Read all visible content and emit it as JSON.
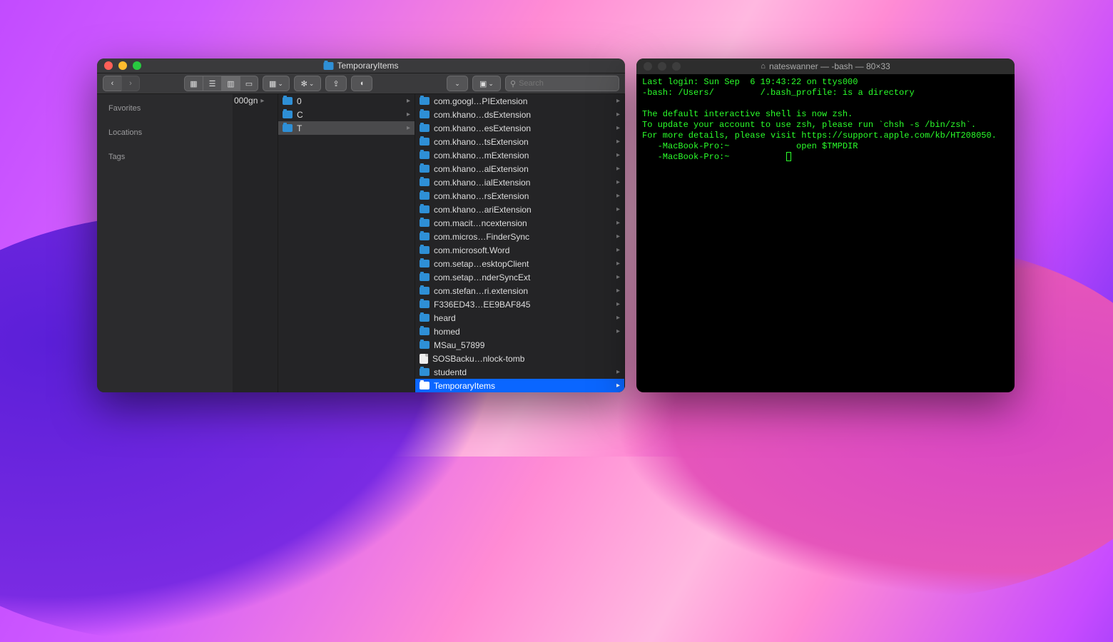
{
  "finder": {
    "title": "TemporaryItems",
    "sidebar": {
      "favorites": "Favorites",
      "locations": "Locations",
      "tags": "Tags"
    },
    "search_placeholder": "Search",
    "col1_label": "000gn",
    "col2": [
      {
        "name": "0",
        "selected": false
      },
      {
        "name": "C",
        "selected": false
      },
      {
        "name": "T",
        "selected": true
      }
    ],
    "col3": [
      {
        "name": "com.googl…PIExtension",
        "type": "folder",
        "arrow": true
      },
      {
        "name": "com.khano…dsExtension",
        "type": "folder",
        "arrow": true
      },
      {
        "name": "com.khano…esExtension",
        "type": "folder",
        "arrow": true
      },
      {
        "name": "com.khano…tsExtension",
        "type": "folder",
        "arrow": true
      },
      {
        "name": "com.khano…mExtension",
        "type": "folder",
        "arrow": true
      },
      {
        "name": "com.khano…alExtension",
        "type": "folder",
        "arrow": true
      },
      {
        "name": "com.khano…ialExtension",
        "type": "folder",
        "arrow": true
      },
      {
        "name": "com.khano…rsExtension",
        "type": "folder",
        "arrow": true
      },
      {
        "name": "com.khano…ariExtension",
        "type": "folder",
        "arrow": true
      },
      {
        "name": "com.macit…ncextension",
        "type": "folder",
        "arrow": true
      },
      {
        "name": "com.micros…FinderSync",
        "type": "folder",
        "arrow": true
      },
      {
        "name": "com.microsoft.Word",
        "type": "folder",
        "arrow": true
      },
      {
        "name": "com.setap…esktopClient",
        "type": "folder",
        "arrow": true
      },
      {
        "name": "com.setap…nderSyncExt",
        "type": "folder",
        "arrow": true
      },
      {
        "name": "com.stefan…ri.extension",
        "type": "folder",
        "arrow": true
      },
      {
        "name": "F336ED43…EE9BAF845",
        "type": "folder",
        "arrow": true
      },
      {
        "name": "heard",
        "type": "folder",
        "arrow": true
      },
      {
        "name": "homed",
        "type": "folder",
        "arrow": true
      },
      {
        "name": "MSau_57899",
        "type": "folder",
        "arrow": false
      },
      {
        "name": "SOSBacku…nlock-tomb",
        "type": "file",
        "arrow": false
      },
      {
        "name": "studentd",
        "type": "folder",
        "arrow": true
      },
      {
        "name": "TemporaryItems",
        "type": "folder",
        "arrow": true,
        "active": true
      }
    ]
  },
  "terminal": {
    "title": "nateswanner — -bash — 80×33",
    "lines": [
      "Last login: Sun Sep  6 19:43:22 on ttys000",
      "-bash: /Users/         /.bash_profile: is a directory",
      "",
      "The default interactive shell is now zsh.",
      "To update your account to use zsh, please run `chsh -s /bin/zsh`.",
      "For more details, please visit https://support.apple.com/kb/HT208050.",
      "   -MacBook-Pro:~             open $TMPDIR",
      "   -MacBook-Pro:~           "
    ]
  }
}
